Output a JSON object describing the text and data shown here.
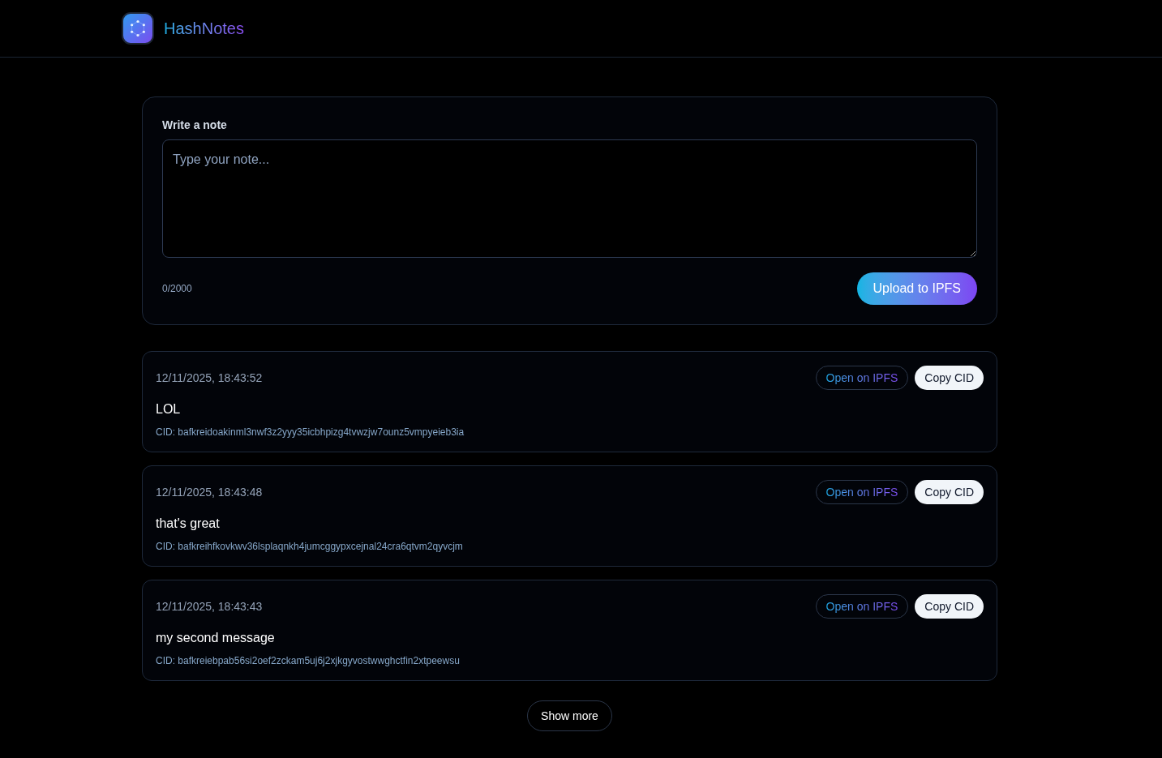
{
  "header": {
    "app_name": "HashNotes"
  },
  "composer": {
    "label": "Write a note",
    "placeholder": "Type your note...",
    "counter": "0/2000",
    "submit_button": "Upload to IPFS"
  },
  "notes": [
    {
      "timestamp": "12/11/2025, 18:43:52",
      "text": "LOL",
      "cid": "CID: bafkreidoakinml3nwf3z2yyy35icbhpizg4tvwzjw7ounz5vmpyeieb3ia",
      "open_button": "Open on IPFS",
      "copy_button": "Copy CID"
    },
    {
      "timestamp": "12/11/2025, 18:43:48",
      "text": "that's great",
      "cid": "CID: bafkreihfkovkwv36lsplaqnkh4jumcggypxcejnal24cra6qtvm2qyvcjm",
      "open_button": "Open on IPFS",
      "copy_button": "Copy CID"
    },
    {
      "timestamp": "12/11/2025, 18:43:43",
      "text": "my second message",
      "cid": "CID: bafkreiebpab56si2oef2zckam5uj6j2xjkgyvostwwghctfin2xtpeewsu",
      "open_button": "Open on IPFS",
      "copy_button": "Copy CID"
    }
  ],
  "show_more_button": "Show more"
}
